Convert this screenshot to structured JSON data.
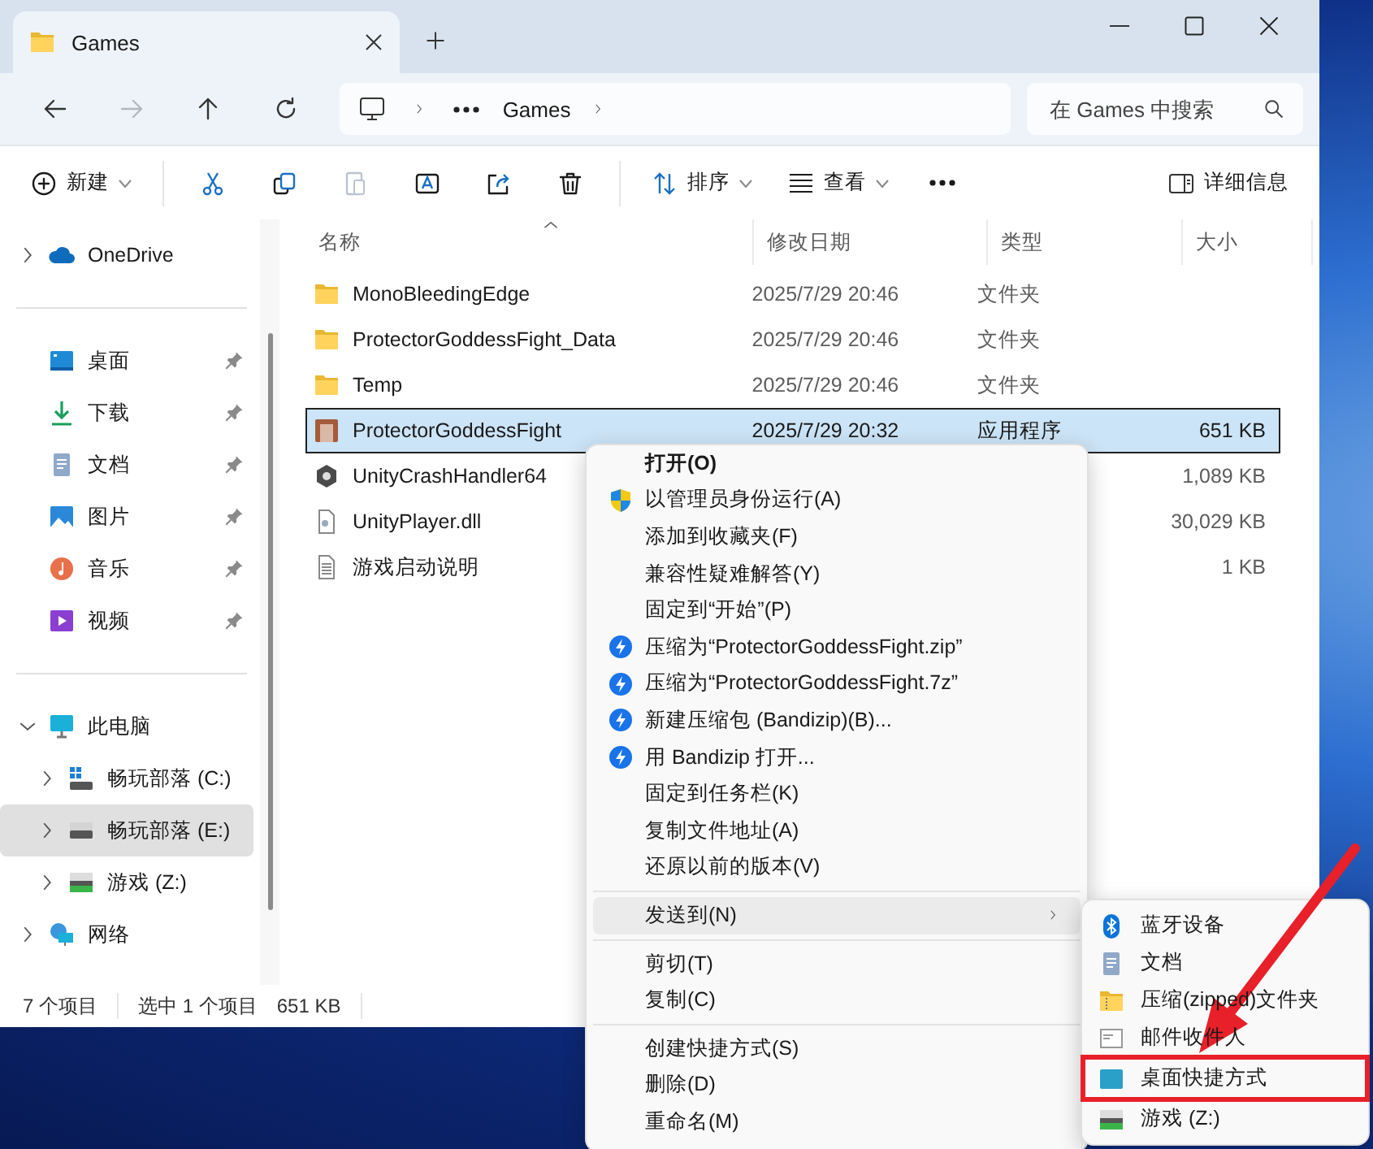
{
  "tab": {
    "title": "Games",
    "selected": true
  },
  "nav": [
    {
      "kind": "back",
      "disabled": false
    },
    {
      "kind": "forward",
      "disabled": true
    },
    {
      "kind": "up",
      "disabled": false
    },
    {
      "kind": "refresh",
      "disabled": false
    }
  ],
  "address": {
    "crumbs": [
      "Games"
    ]
  },
  "search": {
    "placeholder": "在 Games 中搜索"
  },
  "toolbar": [
    {
      "kind": "new",
      "label": "新建",
      "dropdown": true,
      "disabled": false
    },
    {
      "kind": "separator"
    },
    {
      "kind": "cut",
      "disabled": false
    },
    {
      "kind": "copy",
      "disabled": false
    },
    {
      "kind": "paste",
      "disabled": true
    },
    {
      "kind": "rename",
      "disabled": false
    },
    {
      "kind": "share",
      "disabled": false
    },
    {
      "kind": "delete",
      "disabled": false
    },
    {
      "kind": "separator"
    },
    {
      "kind": "sort",
      "label": "排序",
      "dropdown": true,
      "disabled": false
    },
    {
      "kind": "view",
      "label": "查看",
      "dropdown": true,
      "disabled": false
    },
    {
      "kind": "more",
      "disabled": false
    }
  ],
  "details_button": {
    "label": "详细信息"
  },
  "sidebar": {
    "sections": [
      [
        {
          "label": "OneDrive",
          "kind": "onedrive",
          "expanded": false,
          "selected": false
        }
      ],
      [
        {
          "label": "桌面",
          "kind": "desktop",
          "pinned": true,
          "selected": false
        },
        {
          "label": "下载",
          "kind": "downloads",
          "pinned": true,
          "selected": false
        },
        {
          "label": "文档",
          "kind": "documents",
          "pinned": true,
          "selected": false
        },
        {
          "label": "图片",
          "kind": "pictures",
          "pinned": true,
          "selected": false
        },
        {
          "label": "音乐",
          "kind": "music",
          "pinned": true,
          "selected": false
        },
        {
          "label": "视频",
          "kind": "videos",
          "pinned": true,
          "selected": false
        }
      ],
      [
        {
          "label": "此电脑",
          "kind": "pc",
          "expanded": true,
          "selected": false,
          "children": [
            {
              "label": "畅玩部落 (C:)",
              "kind": "drive-system",
              "expanded": false,
              "selected": false
            },
            {
              "label": "畅玩部落 (E:)",
              "kind": "drive",
              "expanded": false,
              "selected": true
            },
            {
              "label": "游戏 (Z:)",
              "kind": "drive-game",
              "expanded": false,
              "selected": false
            }
          ]
        },
        {
          "label": "网络",
          "kind": "network",
          "expanded": false,
          "selected": false
        }
      ]
    ]
  },
  "table": {
    "columns": [
      "名称",
      "修改日期",
      "类型",
      "大小"
    ],
    "rows": [
      {
        "name": "MonoBleedingEdge",
        "date": "2025/7/29 20:46",
        "type": "文件夹",
        "kind": "folder",
        "selected": false
      },
      {
        "name": "ProtectorGoddessFight_Data",
        "date": "2025/7/29 20:46",
        "type": "文件夹",
        "kind": "folder",
        "selected": false
      },
      {
        "name": "Temp",
        "date": "2025/7/29 20:46",
        "type": "文件夹",
        "kind": "folder",
        "selected": false
      },
      {
        "name": "ProtectorGoddessFight",
        "date": "2025/7/29 20:32",
        "type": "应用程序",
        "size": "651 KB",
        "kind": "application",
        "selected": true
      },
      {
        "name": "UnityCrashHandler64",
        "size": "1,089 KB",
        "kind": "hex",
        "selected": false
      },
      {
        "name": "UnityPlayer.dll",
        "size": "30,029 KB",
        "kind": "library",
        "selected": false
      },
      {
        "name": "游戏启动说明",
        "size": "1 KB",
        "kind": "text",
        "selected": false
      }
    ]
  },
  "status_bar": {
    "count": "7 个项目",
    "selection": "选中 1 个项目",
    "size": "651 KB"
  },
  "context_menu": [
    {
      "kind": "plain",
      "label": "打开(O)",
      "default": true,
      "selected": false
    },
    {
      "kind": "shield",
      "label": "以管理员身份运行(A)",
      "default": false,
      "selected": false
    },
    {
      "kind": "plain",
      "label": "添加到收藏夹(F)",
      "default": false,
      "selected": false
    },
    {
      "kind": "plain",
      "label": "兼容性疑难解答(Y)",
      "default": false,
      "selected": false
    },
    {
      "kind": "plain",
      "label": "固定到“开始”(P)",
      "default": false,
      "selected": false
    },
    {
      "kind": "bandizip",
      "label": "压缩为“ProtectorGoddessFight.zip”",
      "default": false,
      "selected": false
    },
    {
      "kind": "bandizip",
      "label": "压缩为“ProtectorGoddessFight.7z”",
      "default": false,
      "selected": false
    },
    {
      "kind": "bandizip",
      "label": "新建压缩包 (Bandizip)(B)...",
      "default": false,
      "selected": false
    },
    {
      "kind": "bandizip",
      "label": "用 Bandizip 打开...",
      "default": false,
      "selected": false
    },
    {
      "kind": "plain",
      "label": "固定到任务栏(K)",
      "default": false,
      "selected": false
    },
    {
      "kind": "plain",
      "label": "复制文件地址(A)",
      "default": false,
      "selected": false
    },
    {
      "kind": "plain",
      "label": "还原以前的版本(V)",
      "default": false,
      "selected": false
    },
    {
      "kind": "separator"
    },
    {
      "kind": "plain",
      "label": "发送到(N)",
      "default": false,
      "submenu": true,
      "selected": true
    },
    {
      "kind": "separator"
    },
    {
      "kind": "plain",
      "label": "剪切(T)",
      "default": false,
      "selected": false
    },
    {
      "kind": "plain",
      "label": "复制(C)",
      "default": false,
      "selected": false
    },
    {
      "kind": "separator"
    },
    {
      "kind": "plain",
      "label": "创建快捷方式(S)",
      "default": false,
      "selected": false
    },
    {
      "kind": "plain",
      "label": "删除(D)",
      "default": false,
      "selected": false
    },
    {
      "kind": "plain",
      "label": "重命名(M)",
      "default": false,
      "selected": false
    }
  ],
  "send_to_menu": [
    {
      "label": "蓝牙设备",
      "kind": "bluetooth",
      "highlighted": false
    },
    {
      "label": "文档",
      "kind": "documents",
      "highlighted": false
    },
    {
      "label": "压缩(zipped)文件夹",
      "kind": "zip-folder",
      "highlighted": false
    },
    {
      "label": "邮件收件人",
      "kind": "mail",
      "highlighted": false
    },
    {
      "label": "桌面快捷方式",
      "kind": "desktop-shortcut",
      "highlighted": true
    },
    {
      "label": "游戏 (Z:)",
      "kind": "drive-game",
      "highlighted": false
    }
  ]
}
